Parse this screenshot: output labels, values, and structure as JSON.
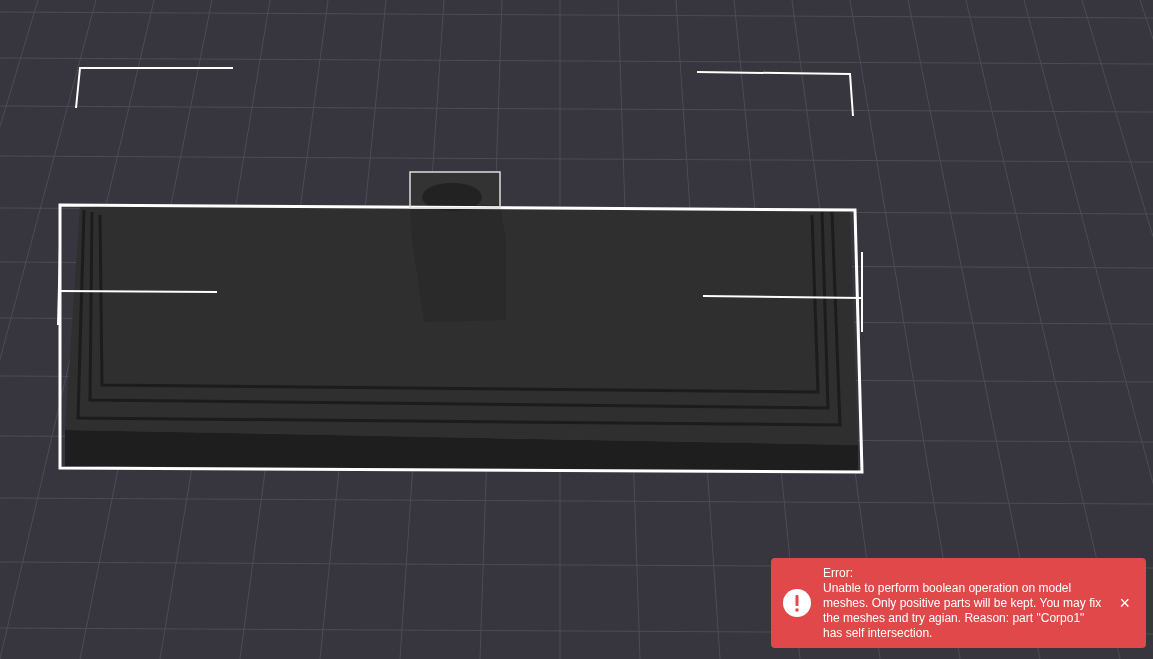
{
  "notification": {
    "kind": "error",
    "title": "Error:",
    "message": "Unable to perform boolean operation on model meshes. Only positive parts will be kept. You may fix the meshes and try agian. Reason: part \"Corpo1\" has self intersection.",
    "close": "×"
  }
}
